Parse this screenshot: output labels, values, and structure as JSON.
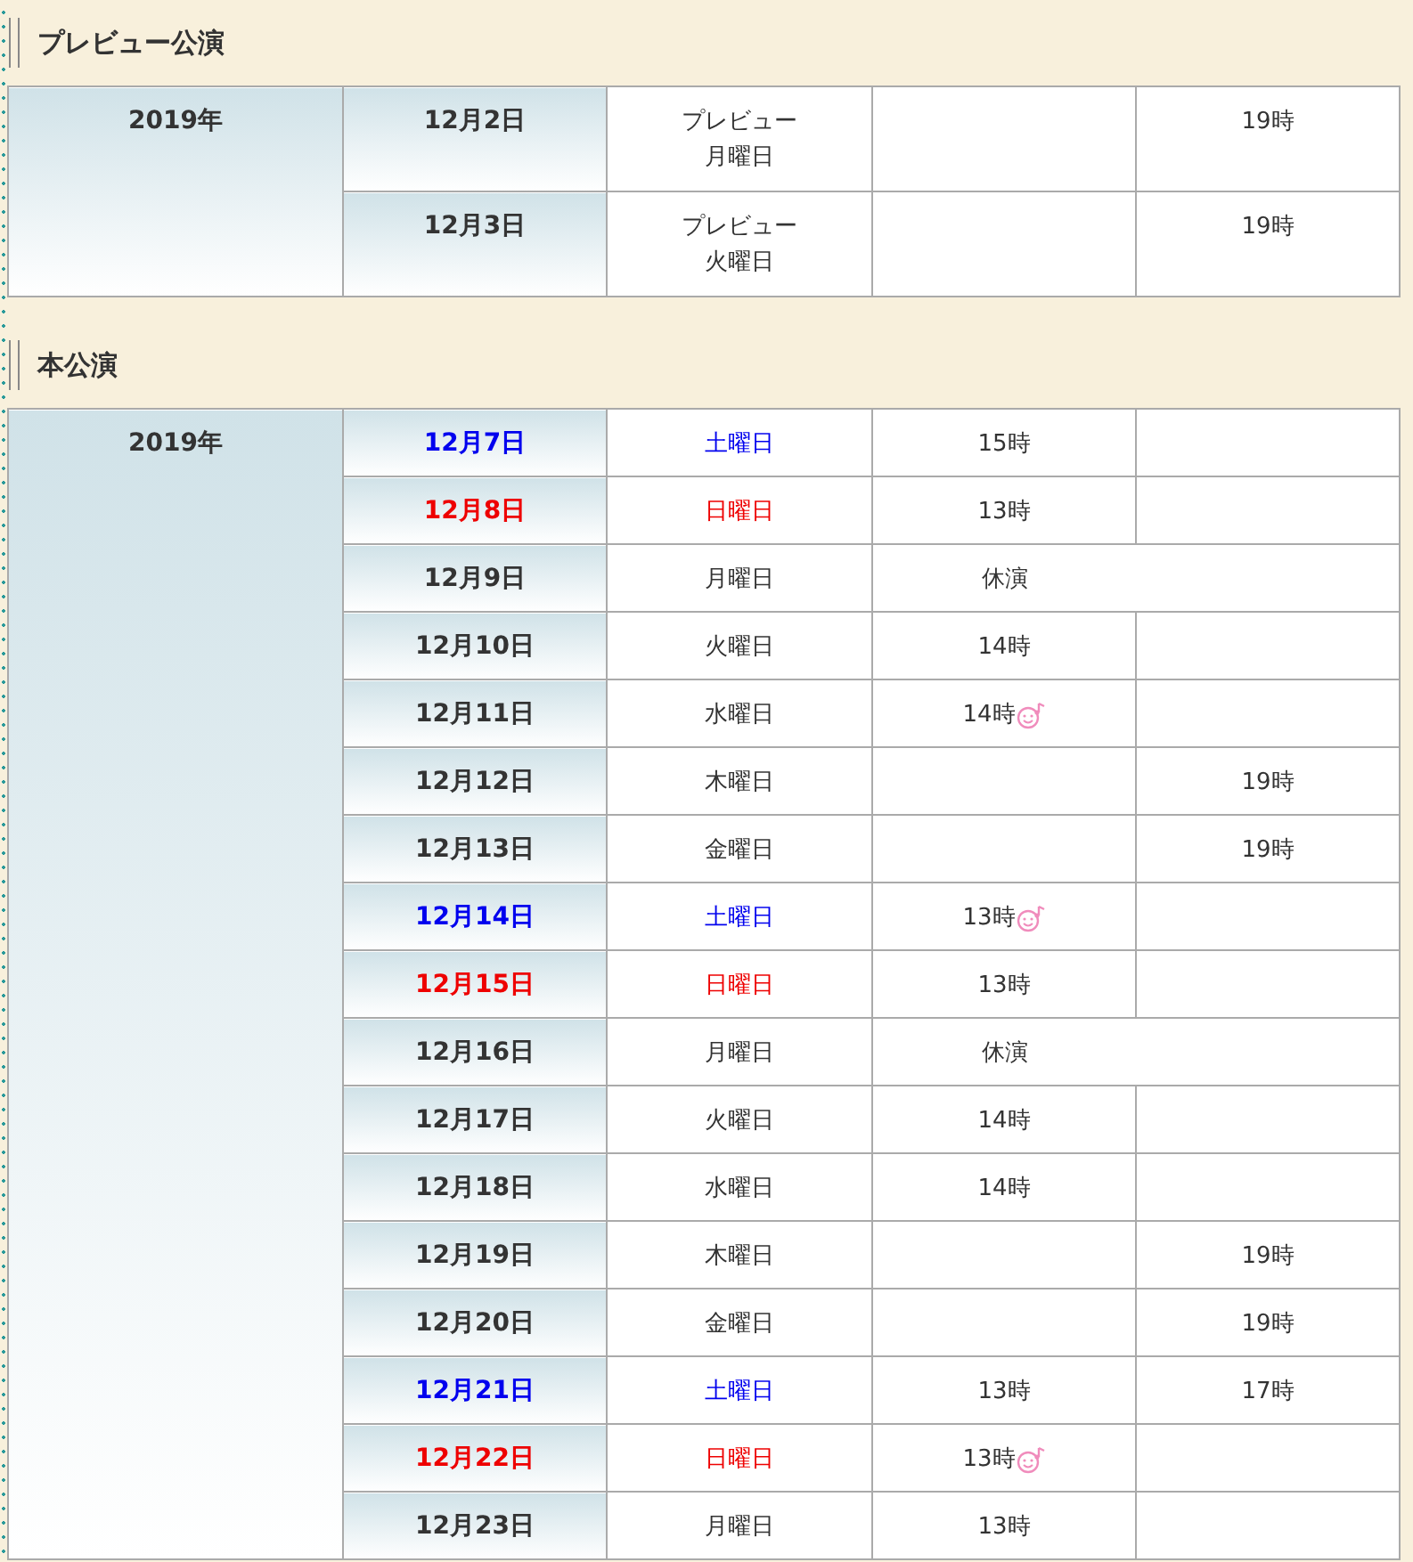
{
  "sections": [
    {
      "title": "プレビュー公演",
      "kind": "preview",
      "year": "2019年",
      "rows": [
        {
          "date": "12月2日",
          "color": "#333333",
          "day_lines": [
            "プレビュー",
            "月曜日"
          ],
          "matinee": "",
          "evening": "19時",
          "closed": false,
          "special": false
        },
        {
          "date": "12月3日",
          "color": "#333333",
          "day_lines": [
            "プレビュー",
            "火曜日"
          ],
          "matinee": "",
          "evening": "19時",
          "closed": false,
          "special": false
        }
      ]
    },
    {
      "title": "本公演",
      "kind": "main",
      "year": "2019年",
      "rows": [
        {
          "date": "12月7日",
          "color": "#0000ee",
          "day_lines": [
            "土曜日"
          ],
          "matinee": "15時",
          "evening": "",
          "closed": false,
          "special": false
        },
        {
          "date": "12月8日",
          "color": "#ee0000",
          "day_lines": [
            "日曜日"
          ],
          "matinee": "13時",
          "evening": "",
          "closed": false,
          "special": false
        },
        {
          "date": "12月9日",
          "color": "#333333",
          "day_lines": [
            "月曜日"
          ],
          "matinee": "休演",
          "evening": "",
          "closed": true,
          "special": false
        },
        {
          "date": "12月10日",
          "color": "#333333",
          "day_lines": [
            "火曜日"
          ],
          "matinee": "14時",
          "evening": "",
          "closed": false,
          "special": false
        },
        {
          "date": "12月11日",
          "color": "#333333",
          "day_lines": [
            "水曜日"
          ],
          "matinee": "14時",
          "evening": "",
          "closed": false,
          "special": true
        },
        {
          "date": "12月12日",
          "color": "#333333",
          "day_lines": [
            "木曜日"
          ],
          "matinee": "",
          "evening": "19時",
          "closed": false,
          "special": false
        },
        {
          "date": "12月13日",
          "color": "#333333",
          "day_lines": [
            "金曜日"
          ],
          "matinee": "",
          "evening": "19時",
          "closed": false,
          "special": false
        },
        {
          "date": "12月14日",
          "color": "#0000ee",
          "day_lines": [
            "土曜日"
          ],
          "matinee": "13時",
          "evening": "",
          "closed": false,
          "special": true
        },
        {
          "date": "12月15日",
          "color": "#ee0000",
          "day_lines": [
            "日曜日"
          ],
          "matinee": "13時",
          "evening": "",
          "closed": false,
          "special": false
        },
        {
          "date": "12月16日",
          "color": "#333333",
          "day_lines": [
            "月曜日"
          ],
          "matinee": "休演",
          "evening": "",
          "closed": true,
          "special": false
        },
        {
          "date": "12月17日",
          "color": "#333333",
          "day_lines": [
            "火曜日"
          ],
          "matinee": "14時",
          "evening": "",
          "closed": false,
          "special": false
        },
        {
          "date": "12月18日",
          "color": "#333333",
          "day_lines": [
            "水曜日"
          ],
          "matinee": "14時",
          "evening": "",
          "closed": false,
          "special": false
        },
        {
          "date": "12月19日",
          "color": "#333333",
          "day_lines": [
            "木曜日"
          ],
          "matinee": "",
          "evening": "19時",
          "closed": false,
          "special": false
        },
        {
          "date": "12月20日",
          "color": "#333333",
          "day_lines": [
            "金曜日"
          ],
          "matinee": "",
          "evening": "19時",
          "closed": false,
          "special": false
        },
        {
          "date": "12月21日",
          "color": "#0000ee",
          "day_lines": [
            "土曜日"
          ],
          "matinee": "13時",
          "evening": "17時",
          "closed": false,
          "special": false
        },
        {
          "date": "12月22日",
          "color": "#ee0000",
          "day_lines": [
            "日曜日"
          ],
          "matinee": "13時",
          "evening": "",
          "closed": false,
          "special": true
        },
        {
          "date": "12月23日",
          "color": "#333333",
          "day_lines": [
            "月曜日"
          ],
          "matinee": "13時",
          "evening": "",
          "closed": false,
          "special": false
        }
      ]
    }
  ]
}
